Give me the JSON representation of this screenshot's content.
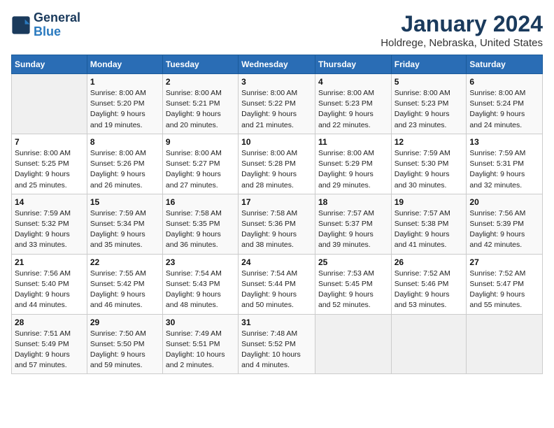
{
  "header": {
    "logo_line1": "General",
    "logo_line2": "Blue",
    "title": "January 2024",
    "subtitle": "Holdrege, Nebraska, United States"
  },
  "days_of_week": [
    "Sunday",
    "Monday",
    "Tuesday",
    "Wednesday",
    "Thursday",
    "Friday",
    "Saturday"
  ],
  "weeks": [
    [
      {
        "num": "",
        "info": ""
      },
      {
        "num": "1",
        "info": "Sunrise: 8:00 AM\nSunset: 5:20 PM\nDaylight: 9 hours\nand 19 minutes."
      },
      {
        "num": "2",
        "info": "Sunrise: 8:00 AM\nSunset: 5:21 PM\nDaylight: 9 hours\nand 20 minutes."
      },
      {
        "num": "3",
        "info": "Sunrise: 8:00 AM\nSunset: 5:22 PM\nDaylight: 9 hours\nand 21 minutes."
      },
      {
        "num": "4",
        "info": "Sunrise: 8:00 AM\nSunset: 5:23 PM\nDaylight: 9 hours\nand 22 minutes."
      },
      {
        "num": "5",
        "info": "Sunrise: 8:00 AM\nSunset: 5:23 PM\nDaylight: 9 hours\nand 23 minutes."
      },
      {
        "num": "6",
        "info": "Sunrise: 8:00 AM\nSunset: 5:24 PM\nDaylight: 9 hours\nand 24 minutes."
      }
    ],
    [
      {
        "num": "7",
        "info": "Sunrise: 8:00 AM\nSunset: 5:25 PM\nDaylight: 9 hours\nand 25 minutes."
      },
      {
        "num": "8",
        "info": "Sunrise: 8:00 AM\nSunset: 5:26 PM\nDaylight: 9 hours\nand 26 minutes."
      },
      {
        "num": "9",
        "info": "Sunrise: 8:00 AM\nSunset: 5:27 PM\nDaylight: 9 hours\nand 27 minutes."
      },
      {
        "num": "10",
        "info": "Sunrise: 8:00 AM\nSunset: 5:28 PM\nDaylight: 9 hours\nand 28 minutes."
      },
      {
        "num": "11",
        "info": "Sunrise: 8:00 AM\nSunset: 5:29 PM\nDaylight: 9 hours\nand 29 minutes."
      },
      {
        "num": "12",
        "info": "Sunrise: 7:59 AM\nSunset: 5:30 PM\nDaylight: 9 hours\nand 30 minutes."
      },
      {
        "num": "13",
        "info": "Sunrise: 7:59 AM\nSunset: 5:31 PM\nDaylight: 9 hours\nand 32 minutes."
      }
    ],
    [
      {
        "num": "14",
        "info": "Sunrise: 7:59 AM\nSunset: 5:32 PM\nDaylight: 9 hours\nand 33 minutes."
      },
      {
        "num": "15",
        "info": "Sunrise: 7:59 AM\nSunset: 5:34 PM\nDaylight: 9 hours\nand 35 minutes."
      },
      {
        "num": "16",
        "info": "Sunrise: 7:58 AM\nSunset: 5:35 PM\nDaylight: 9 hours\nand 36 minutes."
      },
      {
        "num": "17",
        "info": "Sunrise: 7:58 AM\nSunset: 5:36 PM\nDaylight: 9 hours\nand 38 minutes."
      },
      {
        "num": "18",
        "info": "Sunrise: 7:57 AM\nSunset: 5:37 PM\nDaylight: 9 hours\nand 39 minutes."
      },
      {
        "num": "19",
        "info": "Sunrise: 7:57 AM\nSunset: 5:38 PM\nDaylight: 9 hours\nand 41 minutes."
      },
      {
        "num": "20",
        "info": "Sunrise: 7:56 AM\nSunset: 5:39 PM\nDaylight: 9 hours\nand 42 minutes."
      }
    ],
    [
      {
        "num": "21",
        "info": "Sunrise: 7:56 AM\nSunset: 5:40 PM\nDaylight: 9 hours\nand 44 minutes."
      },
      {
        "num": "22",
        "info": "Sunrise: 7:55 AM\nSunset: 5:42 PM\nDaylight: 9 hours\nand 46 minutes."
      },
      {
        "num": "23",
        "info": "Sunrise: 7:54 AM\nSunset: 5:43 PM\nDaylight: 9 hours\nand 48 minutes."
      },
      {
        "num": "24",
        "info": "Sunrise: 7:54 AM\nSunset: 5:44 PM\nDaylight: 9 hours\nand 50 minutes."
      },
      {
        "num": "25",
        "info": "Sunrise: 7:53 AM\nSunset: 5:45 PM\nDaylight: 9 hours\nand 52 minutes."
      },
      {
        "num": "26",
        "info": "Sunrise: 7:52 AM\nSunset: 5:46 PM\nDaylight: 9 hours\nand 53 minutes."
      },
      {
        "num": "27",
        "info": "Sunrise: 7:52 AM\nSunset: 5:47 PM\nDaylight: 9 hours\nand 55 minutes."
      }
    ],
    [
      {
        "num": "28",
        "info": "Sunrise: 7:51 AM\nSunset: 5:49 PM\nDaylight: 9 hours\nand 57 minutes."
      },
      {
        "num": "29",
        "info": "Sunrise: 7:50 AM\nSunset: 5:50 PM\nDaylight: 9 hours\nand 59 minutes."
      },
      {
        "num": "30",
        "info": "Sunrise: 7:49 AM\nSunset: 5:51 PM\nDaylight: 10 hours\nand 2 minutes."
      },
      {
        "num": "31",
        "info": "Sunrise: 7:48 AM\nSunset: 5:52 PM\nDaylight: 10 hours\nand 4 minutes."
      },
      {
        "num": "",
        "info": ""
      },
      {
        "num": "",
        "info": ""
      },
      {
        "num": "",
        "info": ""
      }
    ]
  ]
}
